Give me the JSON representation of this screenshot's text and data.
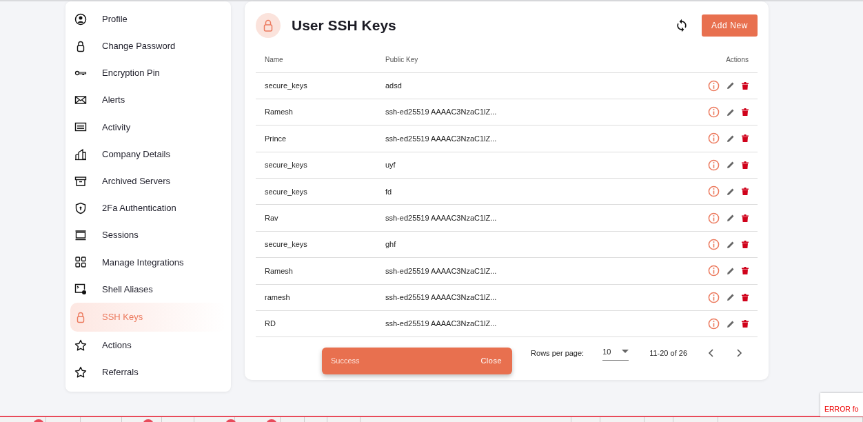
{
  "sidebar": {
    "items": [
      {
        "label": "Profile",
        "selected": false
      },
      {
        "label": "Change Password",
        "selected": false
      },
      {
        "label": "Encryption Pin",
        "selected": false
      },
      {
        "label": "Alerts",
        "selected": false
      },
      {
        "label": "Activity",
        "selected": false
      },
      {
        "label": "Company Details",
        "selected": false
      },
      {
        "label": "Archived Servers",
        "selected": false
      },
      {
        "label": "2Fa Authentication",
        "selected": false
      },
      {
        "label": "Sessions",
        "selected": false
      },
      {
        "label": "Manage Integrations",
        "selected": false
      },
      {
        "label": "Shell Aliases",
        "selected": false
      },
      {
        "label": "SSH Keys",
        "selected": true
      },
      {
        "label": "Actions",
        "selected": false
      },
      {
        "label": "Referrals",
        "selected": false
      }
    ]
  },
  "main": {
    "title": "User SSH Keys",
    "add_button": "Add New",
    "table": {
      "columns": [
        "Name",
        "Public Key",
        "Actions"
      ],
      "rows": [
        {
          "name": "secure_keys",
          "public_key": "adsd"
        },
        {
          "name": "Ramesh",
          "public_key": "ssh-ed25519 AAAAC3NzaC1lZ..."
        },
        {
          "name": "Prince",
          "public_key": "ssh-ed25519 AAAAC3NzaC1lZ..."
        },
        {
          "name": "secure_keys",
          "public_key": "uyf"
        },
        {
          "name": "secure_keys",
          "public_key": "fd"
        },
        {
          "name": "Rav",
          "public_key": "ssh-ed25519 AAAAC3NzaC1lZ..."
        },
        {
          "name": "secure_keys",
          "public_key": "ghf"
        },
        {
          "name": "Ramesh",
          "public_key": "ssh-ed25519 AAAAC3NzaC1lZ..."
        },
        {
          "name": "ramesh",
          "public_key": "ssh-ed25519 AAAAC3NzaC1lZ..."
        },
        {
          "name": "RD",
          "public_key": "ssh-ed25519 AAAAC3NzaC1lZ..."
        }
      ]
    },
    "pagination": {
      "rows_per_page_label": "Rows per page:",
      "rows_per_page": "10",
      "range": "11-20 of 26"
    }
  },
  "toast": {
    "message": "Success",
    "action": "Close"
  },
  "error_box": {
    "text": "ERROR fo"
  }
}
